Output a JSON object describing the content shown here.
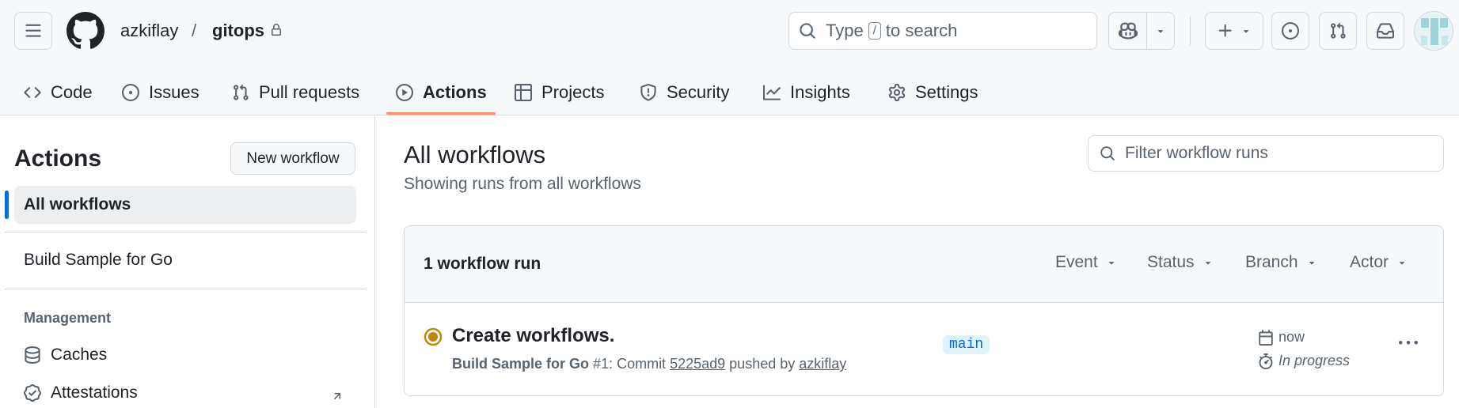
{
  "header": {
    "owner": "azkiflay",
    "separator": "/",
    "repo": "gitops",
    "search": {
      "prefix": "Type",
      "key": "/",
      "suffix": "to search"
    }
  },
  "tabs": [
    {
      "label": "Code",
      "icon": "code-icon"
    },
    {
      "label": "Issues",
      "icon": "issue-opened-icon"
    },
    {
      "label": "Pull requests",
      "icon": "git-pull-request-icon"
    },
    {
      "label": "Actions",
      "icon": "play-icon",
      "active": true
    },
    {
      "label": "Projects",
      "icon": "table-icon"
    },
    {
      "label": "Security",
      "icon": "shield-icon"
    },
    {
      "label": "Insights",
      "icon": "graph-icon"
    },
    {
      "label": "Settings",
      "icon": "gear-icon"
    }
  ],
  "sidebar": {
    "title": "Actions",
    "new_workflow": "New workflow",
    "all_workflows": "All workflows",
    "workflows": [
      "Build Sample for Go"
    ],
    "management_heading": "Management",
    "management_items": [
      {
        "label": "Caches",
        "icon": "database-icon"
      },
      {
        "label": "Attestations",
        "icon": "verified-icon"
      }
    ]
  },
  "main": {
    "title": "All workflows",
    "subtitle": "Showing runs from all workflows",
    "filter_placeholder": "Filter workflow runs",
    "runs_count": "1 workflow run",
    "filters": [
      "Event",
      "Status",
      "Branch",
      "Actor"
    ],
    "runs": [
      {
        "title": "Create workflows.",
        "workflow": "Build Sample for Go",
        "run_number": "#1",
        "meta_middle": ": Commit",
        "commit": "5225ad9",
        "pushed_by": "pushed by",
        "actor": "azkiflay",
        "branch": "main",
        "when": "now",
        "status_text": "In progress",
        "status_color": "#bf8700"
      }
    ]
  },
  "colors": {
    "accent": "#0969da",
    "tab_underline": "#fd8c73",
    "in_progress": "#bf8700"
  }
}
